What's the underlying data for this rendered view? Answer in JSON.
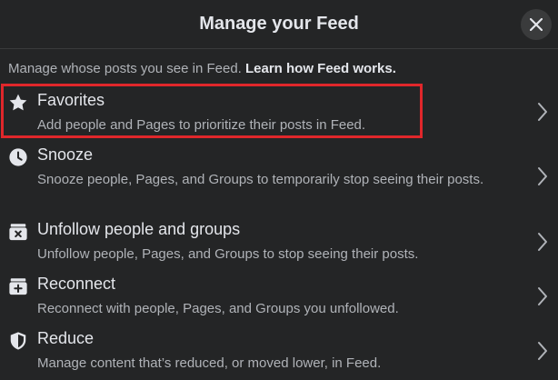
{
  "dialog": {
    "title": "Manage your Feed",
    "close_icon": "close-icon"
  },
  "intro": {
    "text": "Manage whose posts you see in Feed.",
    "link": "Learn how Feed works."
  },
  "items": [
    {
      "label": "Favorites",
      "description": "Add people and Pages to prioritize their posts in Feed.",
      "icon": "star-icon"
    },
    {
      "label": "Snooze",
      "description": "Snooze people, Pages, and Groups to temporarily stop seeing their posts.",
      "icon": "clock-icon"
    },
    {
      "label": "Unfollow people and groups",
      "description": "Unfollow people, Pages, and Groups to stop seeing their posts.",
      "icon": "unfollow-box-icon"
    },
    {
      "label": "Reconnect",
      "description": "Reconnect with people, Pages, and Groups you unfollowed.",
      "icon": "reconnect-box-icon"
    },
    {
      "label": "Reduce",
      "description": "Manage content that’s reduced, or moved lower, in Feed.",
      "icon": "shield-icon"
    }
  ],
  "colors": {
    "background": "#242526",
    "primary_text": "#e4e6eb",
    "secondary_text": "#b0b3b8",
    "highlight_border": "#e0272b"
  }
}
